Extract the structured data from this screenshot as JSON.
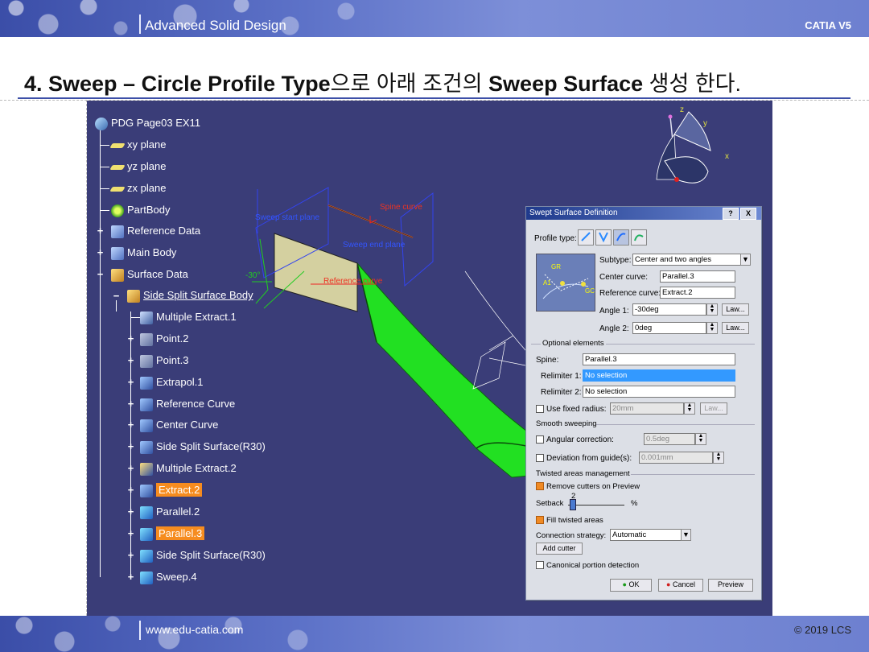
{
  "header": {
    "title": "Advanced Solid Design",
    "product": "CATIA V5"
  },
  "heading": {
    "part1": "4. Sweep – Circle Profile Type",
    "part2": "으로 아래 조건의 ",
    "part3": "Sweep Surface",
    "part4": " 생성 한다."
  },
  "footer": {
    "url": "www.edu-catia.com",
    "copyright": "© 2019 LCS"
  },
  "tree": {
    "root": "PDG Page03 EX11",
    "items": [
      {
        "label": "xy plane"
      },
      {
        "label": "yz plane"
      },
      {
        "label": "zx plane"
      },
      {
        "label": "PartBody"
      },
      {
        "label": "Reference Data"
      },
      {
        "label": "Main Body"
      },
      {
        "label": "Surface Data"
      },
      {
        "label": "Side Split Surface Body"
      },
      {
        "label": "Multiple Extract.1"
      },
      {
        "label": "Point.2"
      },
      {
        "label": "Point.3"
      },
      {
        "label": "Extrapol.1"
      },
      {
        "label": "Reference Curve"
      },
      {
        "label": "Center Curve"
      },
      {
        "label": "Side Split Surface(R30)"
      },
      {
        "label": "Multiple Extract.2"
      },
      {
        "label": "Extract.2"
      },
      {
        "label": "Parallel.2"
      },
      {
        "label": "Parallel.3"
      },
      {
        "label": "Side Split Surface(R30)"
      },
      {
        "label": "Sweep.4"
      }
    ]
  },
  "scene": {
    "labels": {
      "sweep_start": "Sweep start plane",
      "sweep_end": "Sweep end plane",
      "spine_curve": "Spine curve",
      "reference_curve": "Reference curve",
      "angle": "-30°"
    },
    "compass": {
      "x": "x",
      "y": "y",
      "z": "z"
    },
    "colors": {
      "surface": "#22e022",
      "background": "#3a3d78",
      "highlight": "#f68c1f"
    }
  },
  "dialog": {
    "title": "Swept Surface Definition",
    "help": "?",
    "close": "X",
    "profile_type_label": "Profile type:",
    "subtype_label": "Subtype:",
    "subtype_value": "Center and two angles",
    "center_curve_label": "Center curve:",
    "center_curve_value": "Parallel.3",
    "reference_curve_label": "Reference curve:",
    "reference_curve_value": "Extract.2",
    "angle1_label": "Angle 1:",
    "angle1_value": "-30deg",
    "angle2_label": "Angle 2:",
    "angle2_value": "0deg",
    "law_label": "Law...",
    "preview_labels": {
      "gr": "GR",
      "gc": "GC",
      "a1": "A1"
    },
    "optional_elements": "Optional elements",
    "spine_label": "Spine:",
    "spine_value": "Parallel.3",
    "relimiter1_label": "Relimiter 1:",
    "relimiter1_value": "No selection",
    "relimiter2_label": "Relimiter 2:",
    "relimiter2_value": "No selection",
    "use_fixed_radius": "Use fixed radius:",
    "fixed_radius_value": "20mm",
    "smooth_sweeping": "Smooth sweeping",
    "angular_correction": "Angular correction:",
    "angular_correction_value": "0.5deg",
    "deviation": "Deviation from guide(s):",
    "deviation_value": "0.001mm",
    "twisted_areas": "Twisted areas management",
    "remove_cutters": "Remove cutters on Preview",
    "setback_label": "Setback",
    "setback_value": "2",
    "setback_unit": "%",
    "fill_twisted": "Fill twisted areas",
    "connection_strategy_label": "Connection strategy:",
    "connection_strategy_value": "Automatic",
    "add_cutter": "Add cutter",
    "canonical": "Canonical portion detection",
    "ok": "OK",
    "cancel": "Cancel",
    "preview": "Preview"
  }
}
